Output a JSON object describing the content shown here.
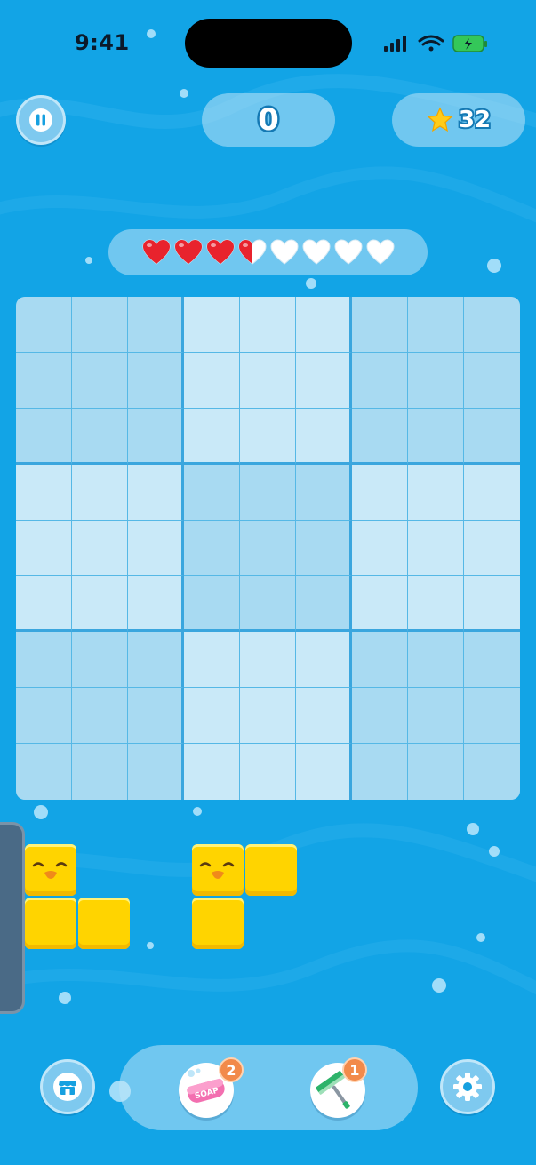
{
  "status_bar": {
    "time": "9:41"
  },
  "hud": {
    "score": "0",
    "stars": "32"
  },
  "lives": {
    "total": 8,
    "filled": 3.5
  },
  "board": {
    "rows": 9,
    "cols": 9
  },
  "boosters": [
    {
      "name": "soap",
      "label": "SOAP",
      "count": "2"
    },
    {
      "name": "squeegee",
      "count": "1"
    }
  ],
  "colors": {
    "background": "#12a4e6",
    "block": "#ffd400",
    "heart_red": "#e8232d",
    "badge": "#f28a4a"
  }
}
